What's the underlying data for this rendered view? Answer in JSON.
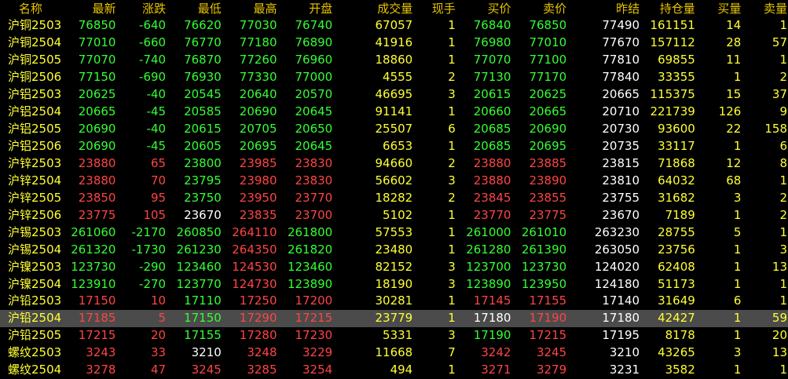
{
  "headers": [
    "名称",
    "最新",
    "涨跌",
    "最低",
    "最高",
    "开盘",
    "成交量",
    "现手",
    "买价",
    "卖价",
    "昨结",
    "持仓量",
    "买量",
    "卖量"
  ],
  "selected_row": 17,
  "colors": {
    "up": "#ff4444",
    "down": "#33ff33",
    "flat": "#ffffff",
    "accent": "#ffff33",
    "header": "#e7c400",
    "selected_bg": "#4b4b4b"
  },
  "rows": [
    {
      "name": "沪铜2503",
      "last": "76850",
      "chg": "-640",
      "low": "76620",
      "high": "77030",
      "open": "76740",
      "vol": "67057",
      "cur": "1",
      "bid": "76840",
      "ask": "76850",
      "prev": "77490",
      "oi": "161151",
      "bidv": "14",
      "askv": "1"
    },
    {
      "name": "沪铜2504",
      "last": "77010",
      "chg": "-660",
      "low": "76770",
      "high": "77180",
      "open": "76890",
      "vol": "41916",
      "cur": "1",
      "bid": "76980",
      "ask": "77010",
      "prev": "77670",
      "oi": "157112",
      "bidv": "28",
      "askv": "57"
    },
    {
      "name": "沪铜2505",
      "last": "77070",
      "chg": "-740",
      "low": "76870",
      "high": "77260",
      "open": "76960",
      "vol": "18860",
      "cur": "1",
      "bid": "77070",
      "ask": "77100",
      "prev": "77810",
      "oi": "69855",
      "bidv": "11",
      "askv": "1"
    },
    {
      "name": "沪铜2506",
      "last": "77150",
      "chg": "-690",
      "low": "76930",
      "high": "77330",
      "open": "77000",
      "vol": "4555",
      "cur": "2",
      "bid": "77130",
      "ask": "77170",
      "prev": "77840",
      "oi": "33355",
      "bidv": "1",
      "askv": "2"
    },
    {
      "name": "沪铝2503",
      "last": "20625",
      "chg": "-40",
      "low": "20545",
      "high": "20640",
      "open": "20570",
      "vol": "46695",
      "cur": "3",
      "bid": "20615",
      "ask": "20625",
      "prev": "20665",
      "oi": "115375",
      "bidv": "15",
      "askv": "37"
    },
    {
      "name": "沪铝2504",
      "last": "20665",
      "chg": "-45",
      "low": "20585",
      "high": "20690",
      "open": "20645",
      "vol": "91141",
      "cur": "1",
      "bid": "20660",
      "ask": "20665",
      "prev": "20710",
      "oi": "221739",
      "bidv": "126",
      "askv": "9"
    },
    {
      "name": "沪铝2505",
      "last": "20690",
      "chg": "-40",
      "low": "20615",
      "high": "20705",
      "open": "20650",
      "vol": "25507",
      "cur": "6",
      "bid": "20685",
      "ask": "20690",
      "prev": "20730",
      "oi": "93600",
      "bidv": "22",
      "askv": "158"
    },
    {
      "name": "沪铝2506",
      "last": "20690",
      "chg": "-45",
      "low": "20605",
      "high": "20695",
      "open": "20645",
      "vol": "6653",
      "cur": "1",
      "bid": "20685",
      "ask": "20695",
      "prev": "20735",
      "oi": "33117",
      "bidv": "1",
      "askv": "6"
    },
    {
      "name": "沪锌2503",
      "last": "23880",
      "chg": "65",
      "low": "23800",
      "high": "23985",
      "open": "23830",
      "vol": "94660",
      "cur": "2",
      "bid": "23880",
      "ask": "23885",
      "prev": "23815",
      "oi": "71868",
      "bidv": "12",
      "askv": "8"
    },
    {
      "name": "沪锌2504",
      "last": "23880",
      "chg": "70",
      "low": "23795",
      "high": "23980",
      "open": "23830",
      "vol": "56602",
      "cur": "3",
      "bid": "23880",
      "ask": "23890",
      "prev": "23810",
      "oi": "64032",
      "bidv": "68",
      "askv": "1"
    },
    {
      "name": "沪锌2505",
      "last": "23850",
      "chg": "95",
      "low": "23750",
      "high": "23950",
      "open": "23770",
      "vol": "18282",
      "cur": "2",
      "bid": "23845",
      "ask": "23855",
      "prev": "23755",
      "oi": "31682",
      "bidv": "3",
      "askv": "2"
    },
    {
      "name": "沪锌2506",
      "last": "23775",
      "chg": "105",
      "low": "23670",
      "high": "23835",
      "open": "23700",
      "vol": "5102",
      "cur": "1",
      "bid": "23770",
      "ask": "23775",
      "prev": "23670",
      "oi": "7189",
      "bidv": "1",
      "askv": "2"
    },
    {
      "name": "沪锡2503",
      "last": "261060",
      "chg": "-2170",
      "low": "260850",
      "high": "264110",
      "open": "261800",
      "vol": "57553",
      "cur": "1",
      "bid": "261000",
      "ask": "261010",
      "prev": "263230",
      "oi": "28755",
      "bidv": "5",
      "askv": "1"
    },
    {
      "name": "沪锡2504",
      "last": "261320",
      "chg": "-1730",
      "low": "261230",
      "high": "264350",
      "open": "261820",
      "vol": "23480",
      "cur": "1",
      "bid": "261280",
      "ask": "261390",
      "prev": "263050",
      "oi": "23756",
      "bidv": "1",
      "askv": "3"
    },
    {
      "name": "沪镍2503",
      "last": "123730",
      "chg": "-290",
      "low": "123460",
      "high": "124530",
      "open": "123460",
      "vol": "82152",
      "cur": "3",
      "bid": "123700",
      "ask": "123730",
      "prev": "124020",
      "oi": "62408",
      "bidv": "1",
      "askv": "13"
    },
    {
      "name": "沪镍2504",
      "last": "123910",
      "chg": "-270",
      "low": "123770",
      "high": "124730",
      "open": "123890",
      "vol": "18190",
      "cur": "3",
      "bid": "123890",
      "ask": "123950",
      "prev": "124180",
      "oi": "51173",
      "bidv": "1",
      "askv": "1"
    },
    {
      "name": "沪铅2503",
      "last": "17150",
      "chg": "10",
      "low": "17110",
      "high": "17250",
      "open": "17200",
      "vol": "30281",
      "cur": "1",
      "bid": "17145",
      "ask": "17155",
      "prev": "17140",
      "oi": "31649",
      "bidv": "6",
      "askv": "1"
    },
    {
      "name": "沪铅2504",
      "last": "17185",
      "chg": "5",
      "low": "17150",
      "high": "17290",
      "open": "17215",
      "vol": "23779",
      "cur": "1",
      "bid": "17180",
      "ask": "17190",
      "prev": "17180",
      "oi": "42427",
      "bidv": "1",
      "askv": "59"
    },
    {
      "name": "沪铅2505",
      "last": "17215",
      "chg": "20",
      "low": "17155",
      "high": "17280",
      "open": "17230",
      "vol": "5331",
      "cur": "3",
      "bid": "17190",
      "ask": "17215",
      "prev": "17195",
      "oi": "8178",
      "bidv": "1",
      "askv": "20"
    },
    {
      "name": "螺纹2503",
      "last": "3243",
      "chg": "33",
      "low": "3210",
      "high": "3248",
      "open": "3229",
      "vol": "11668",
      "cur": "7",
      "bid": "3242",
      "ask": "3245",
      "prev": "3210",
      "oi": "43265",
      "bidv": "3",
      "askv": "13"
    },
    {
      "name": "螺纹2504",
      "last": "3278",
      "chg": "47",
      "low": "3245",
      "high": "3285",
      "open": "3254",
      "vol": "494",
      "cur": "1",
      "bid": "3271",
      "ask": "3279",
      "prev": "3231",
      "oi": "3582",
      "bidv": "1",
      "askv": "1"
    }
  ]
}
